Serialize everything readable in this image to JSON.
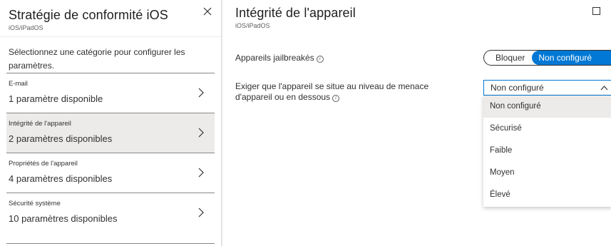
{
  "left_blade": {
    "title": "Stratégie de conformité iOS",
    "subtitle": "iOS/iPadOS",
    "intro": "Sélectionnez une catégorie pour configurer les paramètres.",
    "categories": [
      {
        "name": "E-mail",
        "count": "1 paramètre disponible",
        "selected": false
      },
      {
        "name": "Intégrité de l'appareil",
        "count": "2 paramètres disponibles",
        "selected": true
      },
      {
        "name": "Propriétés de l'appareil",
        "count": "4 paramètres disponibles",
        "selected": false
      },
      {
        "name": "Sécurité système",
        "count": "10 paramètres disponibles",
        "selected": false
      }
    ]
  },
  "right_blade": {
    "title": "Intégrité de l'appareil",
    "subtitle": "iOS/iPadOS",
    "jailbreak": {
      "label": "Appareils jailbreakés",
      "option_block": "Bloquer",
      "option_not_configured": "Non configuré",
      "selected": "Non configuré"
    },
    "threat_level": {
      "label_line1": "Exiger que l'appareil se situe au niveau de menace",
      "label_line2": "d'appareil ou en dessous",
      "value": "Non configuré",
      "options": [
        "Non configuré",
        "Sécurisé",
        "Faible",
        "Moyen",
        "Élevé"
      ],
      "highlighted": "Non configuré"
    }
  },
  "colors": {
    "accent": "#0078d4",
    "selected_bg": "#edebe9",
    "text": "#323130"
  },
  "icons": {
    "close": "close-icon",
    "maximize": "maximize-icon",
    "chevron": "chevron-right-icon",
    "caret": "chevron-up-icon",
    "info": "info-icon"
  }
}
